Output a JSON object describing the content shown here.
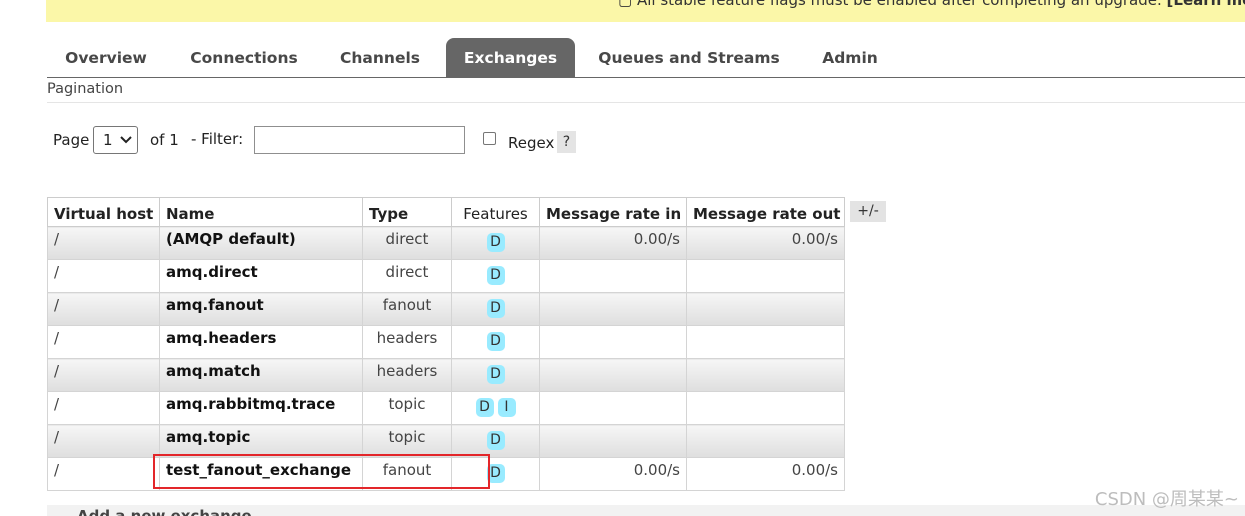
{
  "banner": {
    "text": "All stable feature flags must be enabled after completing an upgrade.",
    "link": "[Learn more]"
  },
  "tabs": [
    {
      "label": "Overview",
      "active": false
    },
    {
      "label": "Connections",
      "active": false
    },
    {
      "label": "Channels",
      "active": false
    },
    {
      "label": "Exchanges",
      "active": true
    },
    {
      "label": "Queues and Streams",
      "active": false
    },
    {
      "label": "Admin",
      "active": false
    }
  ],
  "section_title": "Pagination",
  "pagination": {
    "page_label": "Page",
    "page_value": "1",
    "of_label": "of 1",
    "filter_label": "- Filter:",
    "filter_value": "",
    "regex_label": "Regex",
    "regex_checked": false,
    "help_label": "?"
  },
  "table": {
    "columns": [
      "Virtual host",
      "Name",
      "Type",
      "Features",
      "Message rate in",
      "Message rate out"
    ],
    "toggle_label": "+/-",
    "rows": [
      {
        "vhost": "/",
        "name": "(AMQP default)",
        "type": "direct",
        "features": [
          "D"
        ],
        "rate_in": "0.00/s",
        "rate_out": "0.00/s"
      },
      {
        "vhost": "/",
        "name": "amq.direct",
        "type": "direct",
        "features": [
          "D"
        ],
        "rate_in": "",
        "rate_out": ""
      },
      {
        "vhost": "/",
        "name": "amq.fanout",
        "type": "fanout",
        "features": [
          "D"
        ],
        "rate_in": "",
        "rate_out": ""
      },
      {
        "vhost": "/",
        "name": "amq.headers",
        "type": "headers",
        "features": [
          "D"
        ],
        "rate_in": "",
        "rate_out": ""
      },
      {
        "vhost": "/",
        "name": "amq.match",
        "type": "headers",
        "features": [
          "D"
        ],
        "rate_in": "",
        "rate_out": ""
      },
      {
        "vhost": "/",
        "name": "amq.rabbitmq.trace",
        "type": "topic",
        "features": [
          "D",
          "I"
        ],
        "rate_in": "",
        "rate_out": ""
      },
      {
        "vhost": "/",
        "name": "amq.topic",
        "type": "topic",
        "features": [
          "D"
        ],
        "rate_in": "",
        "rate_out": ""
      },
      {
        "vhost": "/",
        "name": "test_fanout_exchange",
        "type": "fanout",
        "features": [
          "D"
        ],
        "rate_in": "0.00/s",
        "rate_out": "0.00/s"
      }
    ]
  },
  "bottom_section_title": "Add a new exchange",
  "watermark": "CSDN @周某某~",
  "colors": {
    "active_tab": "#666666",
    "banner": "#fbf7a8",
    "feature_badge": "#99ebff",
    "highlight_box": "#e3262a"
  }
}
